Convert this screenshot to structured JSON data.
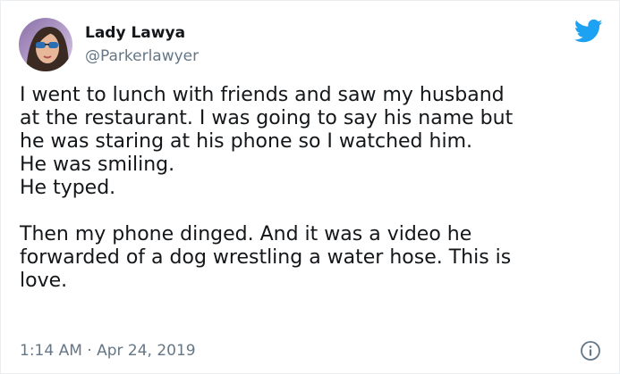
{
  "tweet": {
    "author": {
      "display_name": "Lady Lawya",
      "handle": "@Parkerlawyer",
      "avatar_icon": "profile-photo-woman-sunglasses"
    },
    "text_lines": [
      "I went to lunch with friends and saw my husband",
      "at the restaurant. I was going to say his name but",
      "he was staring at his phone so I watched him.",
      "He was smiling.",
      "He typed.",
      "",
      "Then my phone dinged. And it was a video he",
      "forwarded of a dog wrestling a water hose. This is",
      "love."
    ],
    "timestamp": "1:14 AM · Apr 24, 2019",
    "brand_icon": "twitter-bird-icon",
    "info_icon": "info-icon"
  },
  "colors": {
    "brand": "#1da1f2",
    "text_primary": "#14171a",
    "text_secondary": "#657786"
  }
}
